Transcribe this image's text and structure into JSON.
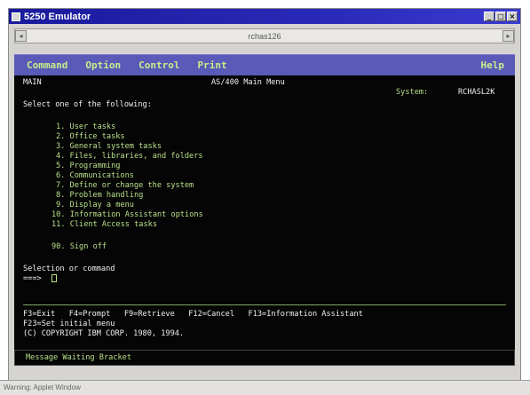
{
  "window": {
    "title": "5250 Emulator",
    "minimize_glyph": "_",
    "maximize_glyph": "□",
    "close_glyph": "×"
  },
  "hostbar": {
    "host": "rchas126",
    "left_glyph": "◂",
    "right_glyph": "▸"
  },
  "menu": {
    "items": [
      "Command",
      "Option",
      "Control",
      "Print"
    ],
    "help": "Help"
  },
  "screen": {
    "panel_id": "MAIN",
    "title": "AS/400 Main Menu",
    "system_label": "System:",
    "system_value": "RCHASL2K",
    "prompt": "Select one of the following:",
    "options": [
      "1. User tasks",
      "2. Office tasks",
      "3. General system tasks",
      "4. Files, libraries, and folders",
      "5. Programming",
      "6. Communications",
      "7. Define or change the system",
      "8. Problem handling",
      "9. Display a menu",
      "10. Information Assistant options",
      "11. Client Access tasks"
    ],
    "signoff": "90. Sign off",
    "selection_label": "Selection or command",
    "input_prompt": "===>",
    "function_keys_line1": "F3=Exit   F4=Prompt   F9=Retrieve   F12=Cancel   F13=Information Assistant",
    "function_keys_line2": "F23=Set initial menu",
    "copyright": "(C) COPYRIGHT IBM CORP. 1980, 1994."
  },
  "status": {
    "message": "Message Waiting Bracket"
  },
  "bottom": {
    "text": "Warning: Applet Window"
  },
  "colors": {
    "menu_bg": "#5a5ab8",
    "terminal_bg": "#050505",
    "terminal_text": "#b8e08a",
    "titlebar": "#2929b8"
  }
}
